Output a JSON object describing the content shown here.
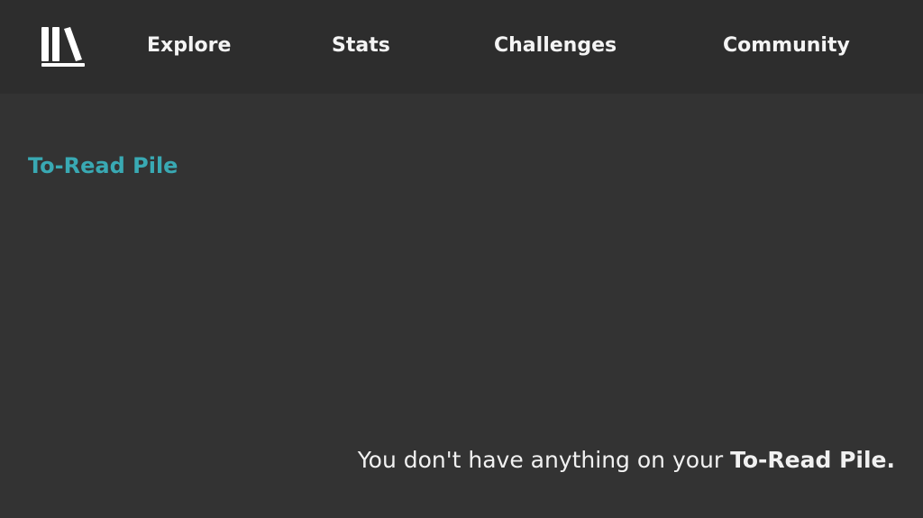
{
  "app": {
    "logo_icon": "bookshelf-icon",
    "background_color": "#333333",
    "topbar_color": "#2d2d2d",
    "accent_color": "#39a9b3"
  },
  "nav": {
    "items": [
      {
        "label": "Explore"
      },
      {
        "label": "Stats"
      },
      {
        "label": "Challenges"
      },
      {
        "label": "Community"
      }
    ]
  },
  "main": {
    "section_title": "To-Read Pile",
    "empty_message_prefix": "You don't have anything on your ",
    "empty_message_emphasis": "To-Read Pile."
  }
}
